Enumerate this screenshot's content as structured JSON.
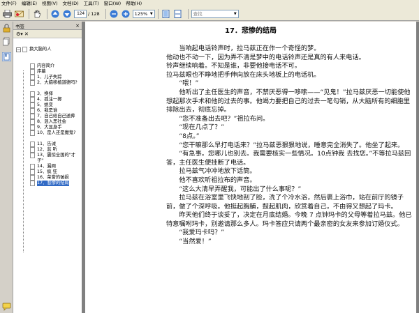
{
  "menu": [
    "文件(F)",
    "编辑(E)",
    "视图(V)",
    "文档(D)",
    "工具(T)",
    "窗口(W)",
    "帮助(H)"
  ],
  "toolbar": {
    "page_current": "124",
    "page_total": "/ 128",
    "zoom": "125%",
    "search_placeholder": "查找"
  },
  "panel": {
    "title": "书签",
    "close": "×",
    "options": "⚙▾  ✕"
  },
  "bookmarks": {
    "root": "换大脑的人",
    "items": [
      {
        "label": "内容简介"
      },
      {
        "label": "序幕"
      },
      {
        "label": "1．儿子失踪"
      },
      {
        "label": "2．大脑移植道德吗?"
      },
      {
        "label": "3．换择"
      },
      {
        "label": "4．孤注一掷"
      },
      {
        "label": "5．蜕变"
      },
      {
        "label": "6．我是谁"
      },
      {
        "label": "7．自己给自己送葬"
      },
      {
        "label": "8．混入黑社会"
      },
      {
        "label": "9．大显身手"
      },
      {
        "label": "10．是人还是魔鬼?"
      },
      {
        "label": "11．告诫"
      },
      {
        "label": "12．监 听"
      },
      {
        "label": "13．震惊全国的\"才子\""
      },
      {
        "label": "14．漏网"
      },
      {
        "label": "15．疯 狂"
      },
      {
        "label": "16．荣誉的破损"
      },
      {
        "label": "17．悲惨的结局",
        "selected": true
      }
    ]
  },
  "document": {
    "chapter_title": "17．悲惨的结局",
    "paragraphs": [
      "　　当响起电话铃声时，拉马兹正在作一个奇怪的梦。",
      "他动也不动一下，因为弄不清是梦中的电话铃声还是真的有人来电话。",
      "铃声继续响着。不知是谁，非要他接电话不可。",
      "拉马兹眼也不睁地把手伸向放在床头地板上的电话机。",
      "　　“喂！”",
      "　　他听出了主任医生的声音，不禁厌恶得一哆嗦——“见鬼！”拉马兹厌恶一切能使他想起那次手术和他的过去的事。他竭力要把自己的过去一笔勾销，从大脑所有的细胞里排除出去，彻底忘掉。",
      "　　“您不准备出去吧？”祖拉布问。",
      "　　“现在几点了？”",
      "　　“8点。”",
      "　　“您干嘛那么早打电话来？”拉马兹恶狠狠地说，睡意完全消失了。他坐了起来。",
      "　　“有急事。您哪儿也别去。我需要核实一些情况。10点钟我 去找您。”不等拉马兹回答，主任医生便挂断了电话。",
      "　　拉马兹气冲冲地放下话筒。",
      "　　他不喜欢听祖拉布的声音。",
      "　　“这么大清早弄醒我，可能出了什么事呢？”",
      "　　拉马兹在浴室里飞快地刮了脸，洗了个冷水浴，然后裹上浴巾，站在前厅的镜子前，做了个深呼吸。他挺起胸脯，鼓起肌肉，欣赏着自己，不由得又想起了玛卡。",
      "　　昨天他们终于谈妥了，决定在月底结婚。今晚 7 点钟玛卡的父母等着拉马兹。他已特意嘱咐玛卡，别邀请那么多人。玛卡答应只请两个最亲密的女友来参加订婚仪式。",
      "　　“我爱玛卡吗？”",
      "　　“当然爱！”"
    ]
  },
  "colors": {
    "chrome": "#ece9d8",
    "selection": "#316ac5",
    "viewer_bg": "#808080"
  }
}
